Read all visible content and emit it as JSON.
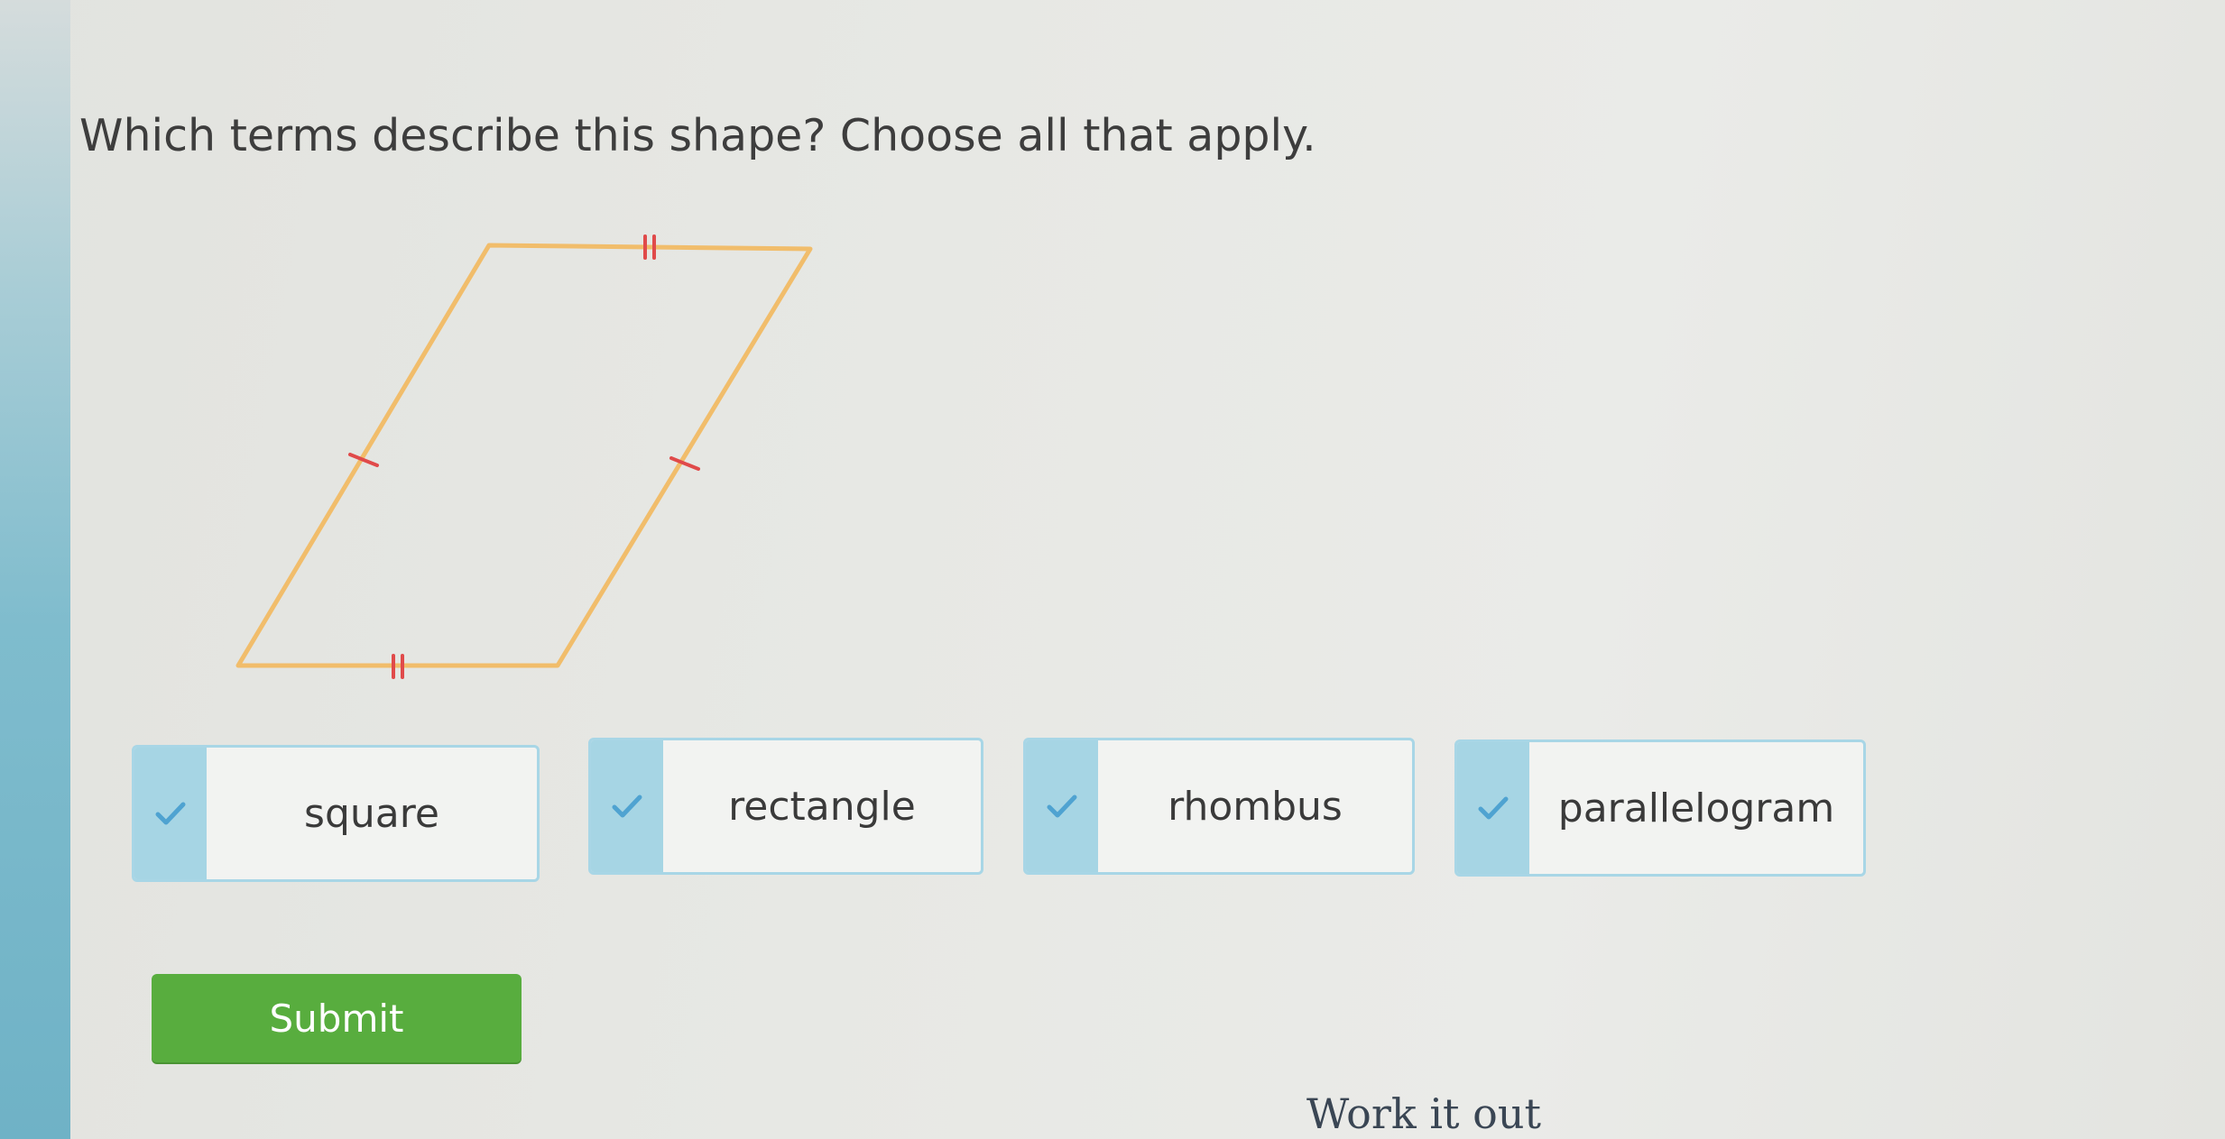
{
  "question": {
    "text": "Which terms describe this shape? Choose all that apply."
  },
  "shape": {
    "type": "parallelogram",
    "outline_color": "#f1bd6b",
    "tick_color": "#e04a4a"
  },
  "choices": [
    {
      "label": "square",
      "icon": "check-icon"
    },
    {
      "label": "rectangle",
      "icon": "check-icon"
    },
    {
      "label": "rhombus",
      "icon": "check-icon"
    },
    {
      "label": "parallelogram",
      "icon": "check-icon"
    }
  ],
  "submit": {
    "label": "Submit",
    "color": "#58ad3e"
  },
  "work_it_out": {
    "label": "Work it out"
  },
  "colors": {
    "accent": "#a6d5e4",
    "check": "#4fa3d1"
  }
}
